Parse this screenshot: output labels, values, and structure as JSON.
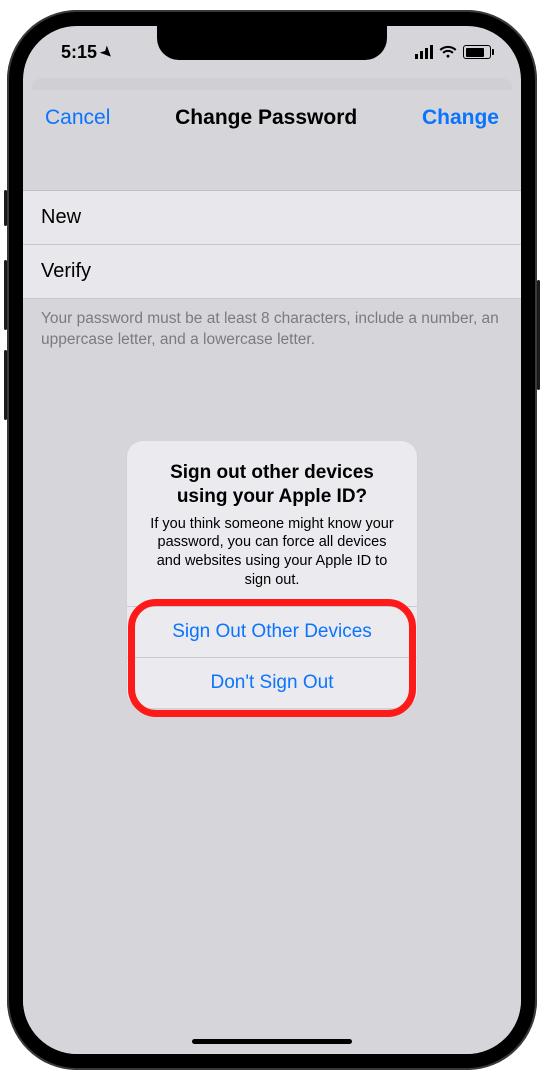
{
  "statusbar": {
    "time": "5:15"
  },
  "nav": {
    "cancel": "Cancel",
    "title": "Change Password",
    "change": "Change"
  },
  "fields": {
    "new_label": "New",
    "verify_label": "Verify"
  },
  "hint": "Your password must be at least 8 characters, include a number, an uppercase letter, and a lowercase letter.",
  "alert": {
    "title": "Sign out other devices using your Apple ID?",
    "message": "If you think someone might know your password, you can force all devices and websites using your Apple ID to sign out.",
    "sign_out": "Sign Out Other Devices",
    "dont_sign_out": "Don't Sign Out"
  }
}
